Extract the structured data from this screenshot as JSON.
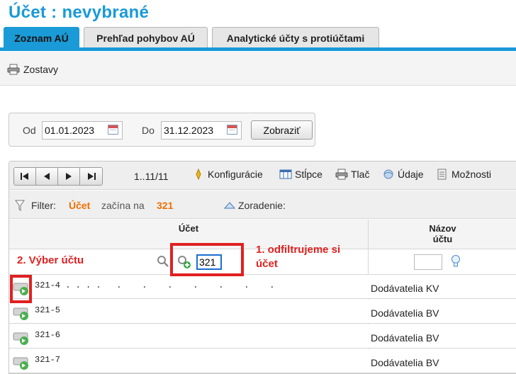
{
  "header": {
    "title": "Účet :  nevybrané"
  },
  "tabs": [
    {
      "label": "Zoznam AÚ",
      "active": true
    },
    {
      "label": "Prehľad pohybov AÚ",
      "active": false
    },
    {
      "label": "Analytické účty s protiúčtami",
      "active": false
    }
  ],
  "toolbar": {
    "reports_label": "Zostavy",
    "reports_icon": "printer-icon"
  },
  "date_filter": {
    "from_label": "Od",
    "from_value": "01.01.2023",
    "to_label": "Do",
    "to_value": "31.12.2023",
    "show_button": "Zobraziť"
  },
  "grid_toolbar": {
    "page_info": "1..11/11",
    "config_label": "Konfigurácie",
    "columns_label": "Stĺpce",
    "print_label": "Tlač",
    "data_label": "Údaje",
    "options_label": "Možnosti"
  },
  "filter_bar": {
    "label": "Filter:",
    "field": "Účet",
    "operator": "začína na",
    "value": "321",
    "sort_label": "Zoradenie:"
  },
  "columns": {
    "account": "Účet",
    "name_line1": "Názov",
    "name_line2": "účtu"
  },
  "filter_row": {
    "account_filter_value": "321",
    "name_filter_value": ""
  },
  "rows": [
    {
      "code": "321-4 . . . .   .    .    .    .    .    .    .",
      "name": "Dodávatelia KV"
    },
    {
      "code": "321-5",
      "name": "Dodávatelia BV"
    },
    {
      "code": "321-6",
      "name": "Dodávatelia BV"
    },
    {
      "code": "321-7",
      "name": "Dodávatelia BV"
    }
  ],
  "annotations": {
    "step1": "1. odfiltrujeme si účet",
    "step2": "2. Výber účtu"
  },
  "colors": {
    "accent": "#1a9ad6",
    "highlight": "#e02020",
    "filter_value": "#f07000"
  }
}
